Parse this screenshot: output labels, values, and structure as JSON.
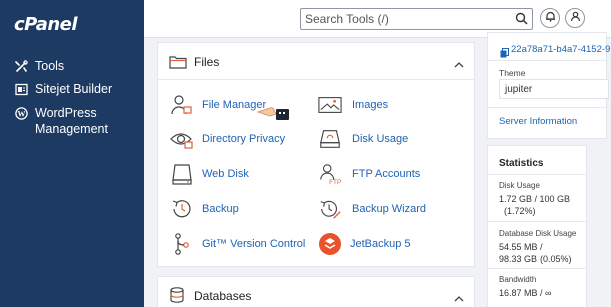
{
  "brand": {
    "logo": "cPanel"
  },
  "sidebar": {
    "items": [
      {
        "label": "Tools",
        "icon": "tools-icon"
      },
      {
        "label": "Sitejet Builder",
        "icon": "sitejet-icon"
      },
      {
        "label": "WordPress Management",
        "icon": "wordpress-icon"
      }
    ]
  },
  "header": {
    "search_placeholder": "Search Tools (/)",
    "icons": [
      "search-icon",
      "bell-icon",
      "user-icon"
    ]
  },
  "files": {
    "title": "Files",
    "tools": [
      {
        "label": "File Manager",
        "icon": "file-manager-icon"
      },
      {
        "label": "Images",
        "icon": "images-icon"
      },
      {
        "label": "Directory Privacy",
        "icon": "directory-privacy-icon"
      },
      {
        "label": "Disk Usage",
        "icon": "disk-usage-icon"
      },
      {
        "label": "Web Disk",
        "icon": "web-disk-icon"
      },
      {
        "label": "FTP Accounts",
        "icon": "ftp-accounts-icon"
      },
      {
        "label": "Backup",
        "icon": "backup-icon"
      },
      {
        "label": "Backup Wizard",
        "icon": "backup-wizard-icon"
      },
      {
        "label": "Git™ Version Control",
        "icon": "git-icon"
      },
      {
        "label": "JetBackup 5",
        "icon": "jetbackup-icon"
      }
    ]
  },
  "databases": {
    "title": "Databases"
  },
  "info": {
    "id_text": "22a78a71-b4a7-4152-9",
    "theme_label": "Theme",
    "theme_value": "jupiter",
    "server_information": "Server Information"
  },
  "statistics": {
    "title": "Statistics",
    "disk_usage_label": "Disk Usage",
    "disk_usage_value": "1.72 GB / 100 GB",
    "disk_usage_percent": "(1.72%)",
    "db_disk_usage_label": "Database Disk Usage",
    "db_disk_usage_value": "54.55 MB /",
    "db_disk_usage_value2": "98.33 GB",
    "db_disk_usage_percent": "(0.05%)",
    "bandwidth_label": "Bandwidth",
    "bandwidth_value": "16.87 MB / ∞"
  },
  "colors": {
    "sidebar": "#1d3a62",
    "link": "#1f63b5",
    "jetbackup": "#e8532b"
  }
}
